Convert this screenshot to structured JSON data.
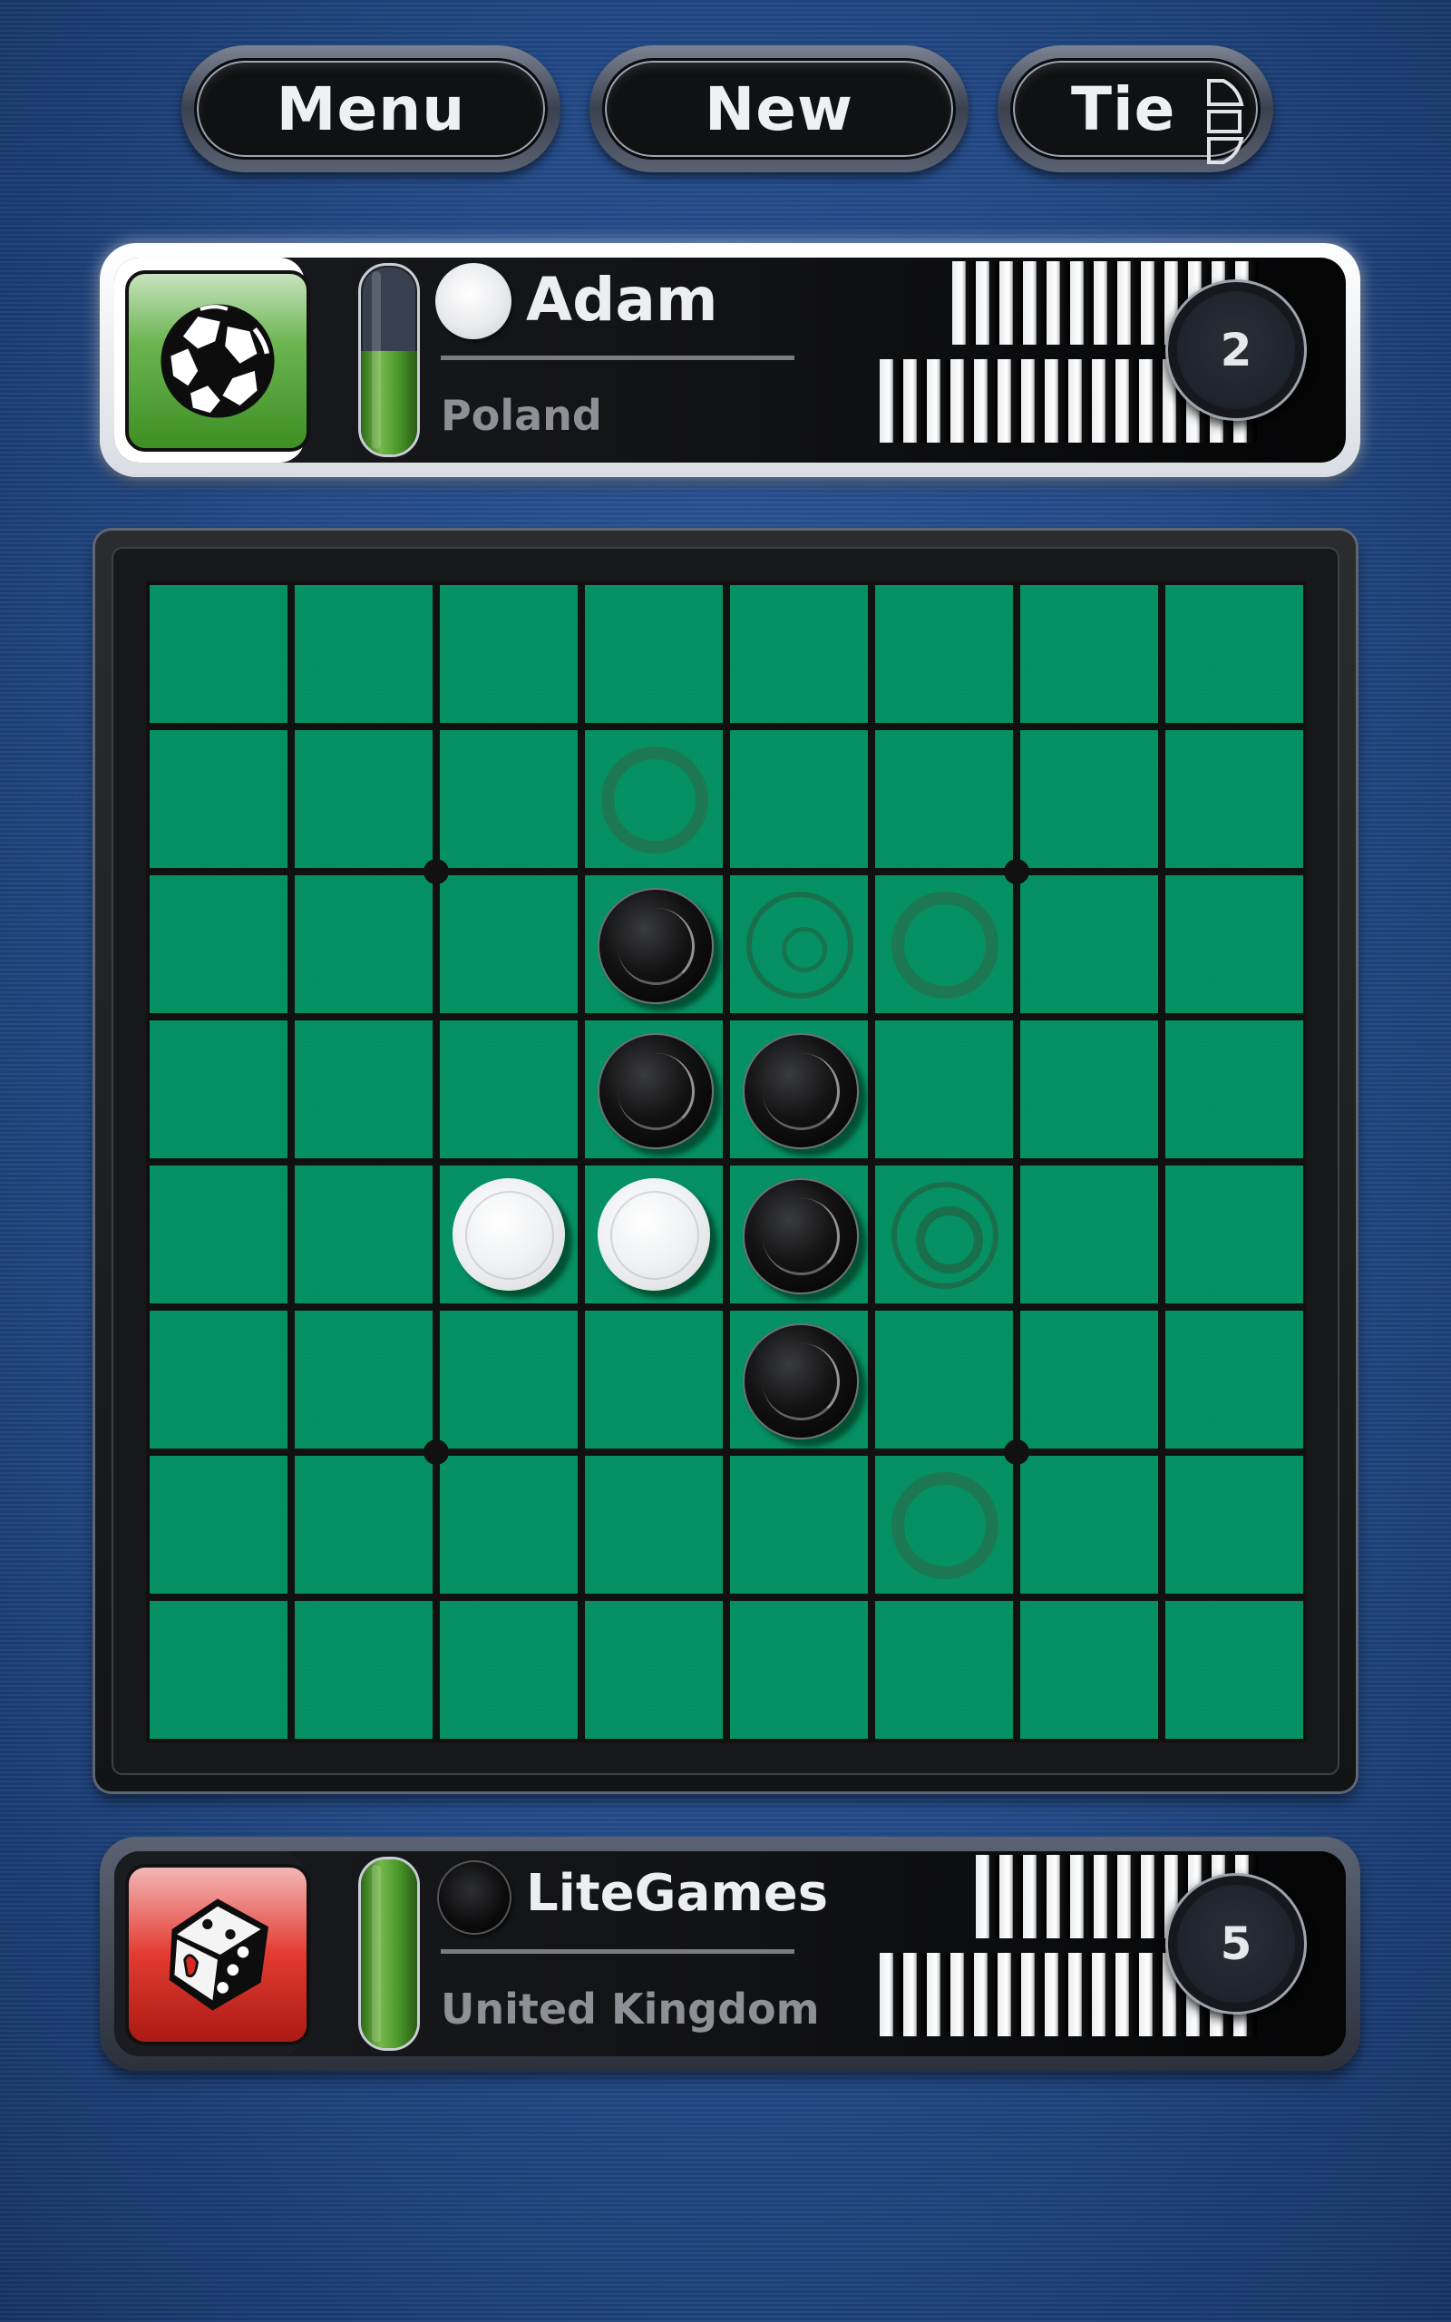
{
  "toolbar": {
    "menu_label": "Menu",
    "new_label": "New",
    "tie_label": "Tie",
    "tie_icon": "scoreboard-icon"
  },
  "players": [
    {
      "name": "Adam",
      "country": "Poland",
      "color": "white",
      "score": "2",
      "avatar_icon": "soccer-ball-icon",
      "avatar_color": "#4c9a2f",
      "timer_fill_percent": 55,
      "active": true,
      "stack_top_count": 13,
      "stack_bottom_count": 16
    },
    {
      "name": "LiteGames",
      "country": "United Kingdom",
      "color": "black",
      "score": "5",
      "avatar_icon": "dice-icon",
      "avatar_color": "#d9281f",
      "timer_fill_percent": 100,
      "active": false,
      "stack_top_count": 12,
      "stack_bottom_count": 16
    }
  ],
  "board": {
    "size": 8,
    "cell_color": "#049063",
    "cells": [
      [
        "",
        "",
        "",
        "",
        "",
        "",
        "",
        ""
      ],
      [
        "",
        "",
        "",
        "hint",
        "",
        "",
        "",
        ""
      ],
      [
        "",
        "",
        "",
        "B",
        "hint-small",
        "hint",
        "",
        ""
      ],
      [
        "",
        "",
        "",
        "B",
        "B",
        "",
        "",
        ""
      ],
      [
        "",
        "",
        "W",
        "W",
        "B",
        "hint-medium",
        "",
        ""
      ],
      [
        "",
        "",
        "",
        "",
        "B",
        "",
        "",
        ""
      ],
      [
        "",
        "",
        "",
        "",
        "",
        "hint",
        "",
        ""
      ],
      [
        "",
        "",
        "",
        "",
        "",
        "",
        "",
        ""
      ]
    ],
    "star_points": [
      [
        2,
        2
      ],
      [
        2,
        6
      ],
      [
        6,
        2
      ],
      [
        6,
        6
      ]
    ]
  },
  "colors": {
    "background": "#234a88",
    "board_green": "#049063",
    "timer_green": "#5aa535"
  }
}
